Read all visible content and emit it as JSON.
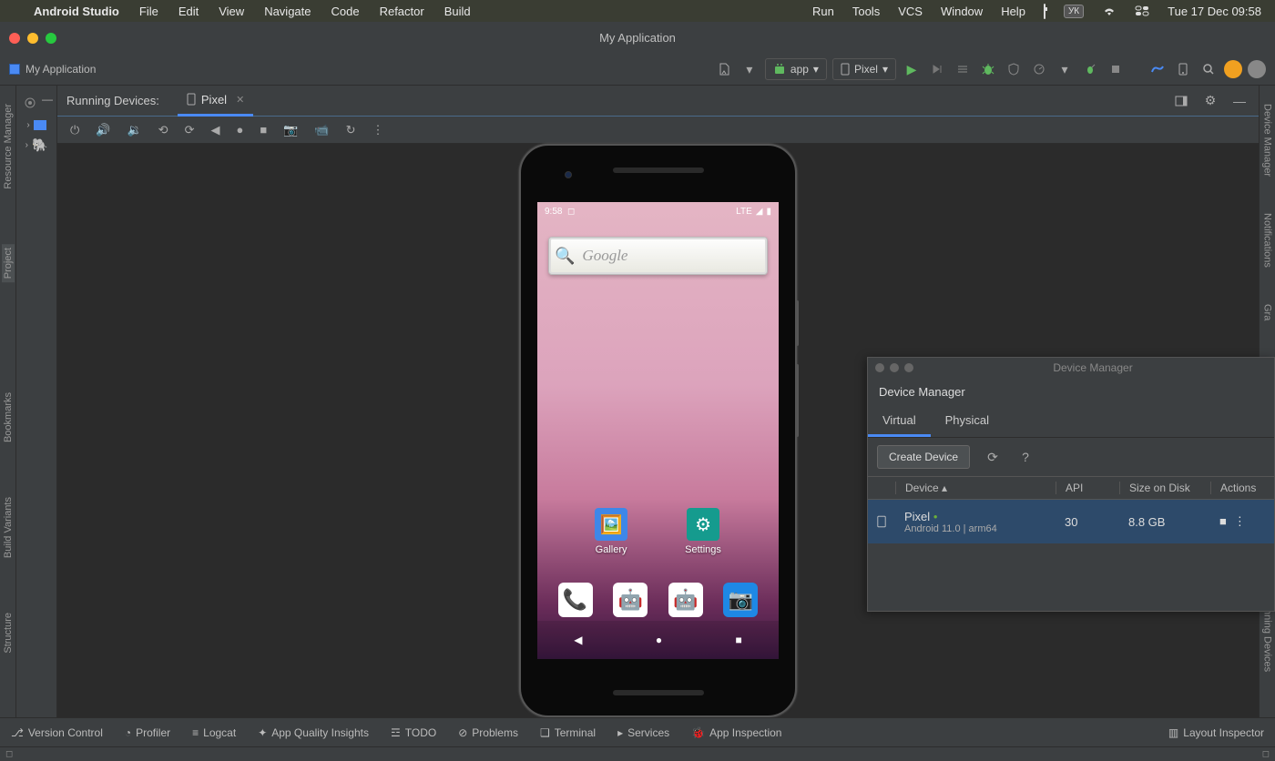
{
  "menubar": {
    "appname": "Android Studio",
    "items": [
      "File",
      "Edit",
      "View",
      "Navigate",
      "Code",
      "Refactor",
      "Build"
    ],
    "right_items": [
      "Run",
      "Tools",
      "VCS",
      "Window",
      "Help"
    ],
    "kbd_badge": "УК",
    "clock": "Tue 17 Dec  09:58"
  },
  "window": {
    "title": "My Application"
  },
  "breadcrumb": {
    "project": "My Application"
  },
  "toolbar": {
    "module": "app",
    "device": "Pixel"
  },
  "running_devices": {
    "label": "Running Devices:",
    "tab": "Pixel"
  },
  "left_tools": [
    "Resource Manager",
    "Project",
    "Bookmarks",
    "Build Variants",
    "Structure"
  ],
  "right_tools": [
    "Device Manager",
    "Notifications",
    "Gra",
    "Running Devices"
  ],
  "emulator": {
    "status_time": "9:58",
    "status_net": "LTE",
    "search_placeholder": "Google",
    "app_gallery": "Gallery",
    "app_settings": "Settings"
  },
  "device_manager": {
    "title": "Device Manager",
    "header": "Device Manager",
    "tabs": {
      "virtual": "Virtual",
      "physical": "Physical"
    },
    "create_btn": "Create Device",
    "cols": {
      "device": "Device",
      "api": "API",
      "size": "Size on Disk",
      "actions": "Actions"
    },
    "row": {
      "name": "Pixel",
      "sub": "Android 11.0 | arm64",
      "api": "30",
      "size": "8.8 GB"
    }
  },
  "bottom": {
    "version_control": "Version Control",
    "profiler": "Profiler",
    "logcat": "Logcat",
    "app_quality": "App Quality Insights",
    "todo": "TODO",
    "problems": "Problems",
    "terminal": "Terminal",
    "services": "Services",
    "app_inspection": "App Inspection",
    "layout_inspector": "Layout Inspector"
  }
}
